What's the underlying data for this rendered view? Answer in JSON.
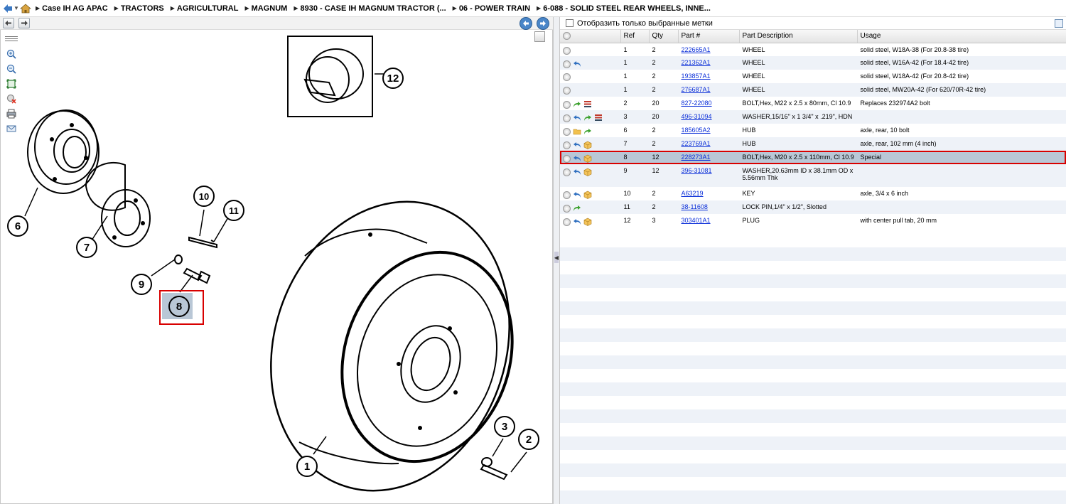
{
  "breadcrumb": [
    "Case IH AG APAC",
    "TRACTORS",
    "AGRICULTURAL",
    "MAGNUM",
    "8930 - CASE IH MAGNUM TRACTOR (...",
    "06 - POWER TRAIN",
    "6-088 - SOLID STEEL REAR WHEELS, INNE..."
  ],
  "filter": {
    "label": "Отобразить только выбранные метки"
  },
  "columns": {
    "ref": "Ref",
    "qty": "Qty",
    "part": "Part #",
    "desc": "Part Description",
    "usage": "Usage"
  },
  "rows": [
    {
      "icons": [],
      "ref": "1",
      "qty": "2",
      "part": "222665A1",
      "desc": "WHEEL",
      "usage": "solid steel, W18A-38 (For 20.8-38 tire)"
    },
    {
      "icons": [
        "undo"
      ],
      "ref": "1",
      "qty": "2",
      "part": "221362A1",
      "desc": "WHEEL",
      "usage": "solid steel, W16A-42 (For 18.4-42 tire)"
    },
    {
      "icons": [],
      "ref": "1",
      "qty": "2",
      "part": "193857A1",
      "desc": "WHEEL",
      "usage": "solid steel, W18A-42 (For 20.8-42 tire)"
    },
    {
      "icons": [],
      "ref": "1",
      "qty": "2",
      "part": "276687A1",
      "desc": "WHEEL",
      "usage": "solid steel, MW20A-42 (For 620/70R-42 tire)"
    },
    {
      "icons": [
        "redo",
        "list"
      ],
      "ref": "2",
      "qty": "20",
      "part": "827-22080",
      "desc": "BOLT,Hex, M22 x 2.5 x 80mm, Cl 10.9",
      "usage": "Replaces 232974A2 bolt"
    },
    {
      "icons": [
        "undo",
        "redo",
        "list"
      ],
      "ref": "3",
      "qty": "20",
      "part": "496-31094",
      "desc": "WASHER,15/16\" x 1 3/4\" x .219\", HDN",
      "usage": ""
    },
    {
      "icons": [
        "folder",
        "redo"
      ],
      "ref": "6",
      "qty": "2",
      "part": "185605A2",
      "desc": "HUB",
      "usage": "axle, rear, 10 bolt"
    },
    {
      "icons": [
        "undo",
        "box"
      ],
      "ref": "7",
      "qty": "2",
      "part": "223769A1",
      "desc": "HUB",
      "usage": "axle, rear, 102 mm (4 inch)"
    },
    {
      "icons": [
        "undo",
        "box"
      ],
      "ref": "8",
      "qty": "12",
      "part": "228273A1",
      "desc": "BOLT,Hex, M20 x 2.5 x 110mm, Cl 10.9",
      "usage": "Special",
      "selected": true
    },
    {
      "icons": [
        "undo",
        "box"
      ],
      "ref": "9",
      "qty": "12",
      "part": "396-31081",
      "desc": "WASHER,20.63mm ID x 38.1mm OD x 5.56mm Thk",
      "usage": "",
      "tall": true
    },
    {
      "icons": [
        "undo",
        "box"
      ],
      "ref": "10",
      "qty": "2",
      "part": "A63219",
      "desc": "KEY",
      "usage": "axle, 3/4 x 6 inch"
    },
    {
      "icons": [
        "redo"
      ],
      "ref": "11",
      "qty": "2",
      "part": "38-11608",
      "desc": "LOCK PIN,1/4\" x 1/2\", Slotted",
      "usage": ""
    },
    {
      "icons": [
        "undo",
        "box"
      ],
      "ref": "12",
      "qty": "3",
      "part": "303401A1",
      "desc": "PLUG",
      "usage": "with center pull tab, 20 mm"
    }
  ],
  "callouts": {
    "c1": "1",
    "c2": "2",
    "c3": "3",
    "c6": "6",
    "c7": "7",
    "c8": "8",
    "c9": "9",
    "c10": "10",
    "c11": "11",
    "c12": "12"
  },
  "colors": {
    "selected_row": "#b9c7d6",
    "highlight": "#d80000",
    "link": "#0a2ed8"
  }
}
